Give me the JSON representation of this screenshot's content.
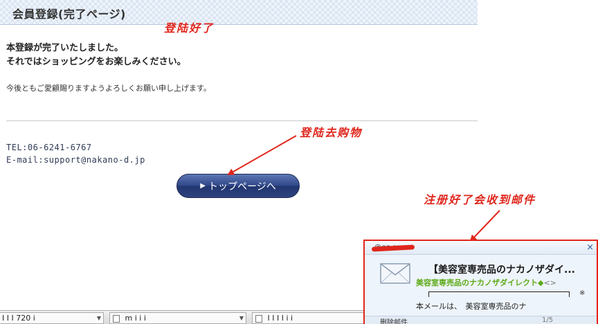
{
  "page": {
    "title": "会員登録(完了ページ)",
    "message_line1": "本登録が完了いたしました。",
    "message_line2": "それではショッピングをお楽しみください。",
    "thanks": "今後ともご愛顧賜りますようよろしくお願い申し上げます。",
    "tel": "TEL:06-6241-6767",
    "email": "E-mail:support@nakano-d.jp",
    "top_button_label": "トップページへ",
    "top_button_icon": "play-triangle-icon"
  },
  "annotations": {
    "login_done": "登陆好了",
    "go_shopping": "登陆去购物",
    "mail_received": "注册好了会收到邮件",
    "color": "#e0261c"
  },
  "notification": {
    "sender": "@qq.com",
    "close_label": "×",
    "subject": "【美容室専売品のナカノザダイ...",
    "from_name": "美容室専売品のナカノザダイレクト◆",
    "from_addr": "<>",
    "note_mark": "※",
    "preview": "本メールは、　美容室専売品のナ",
    "delete_label": "删除邮件",
    "pager": "1/5",
    "icon": "envelope-icon"
  },
  "taskbar": {
    "items": [
      {
        "label": "I  I  I  720 i"
      },
      {
        "label": "m             i i i"
      },
      {
        "label": "  I  I  I  I  i i"
      }
    ]
  },
  "colors": {
    "button": "#2d4380",
    "from_name": "#5daa18",
    "header_bg": "#eef3fa"
  }
}
